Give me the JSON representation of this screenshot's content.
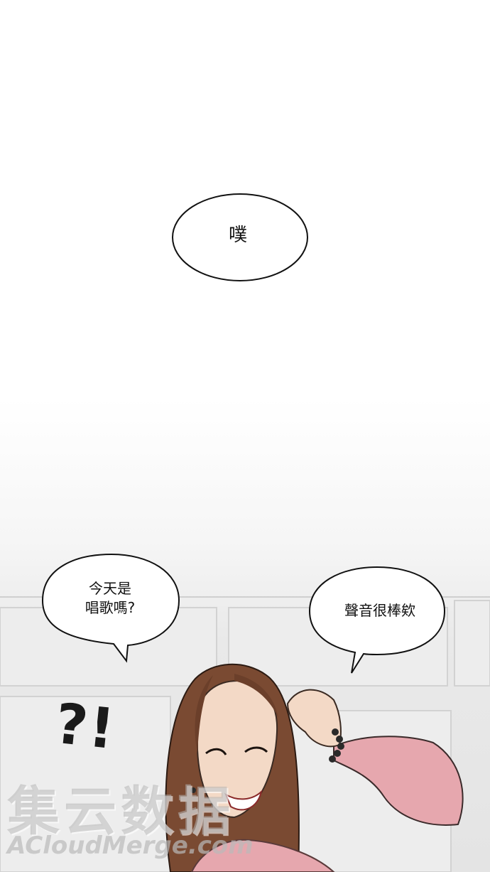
{
  "panel_top": {
    "bubble": {
      "text": "噗"
    }
  },
  "panel_bottom": {
    "bubble_left": {
      "line1": "今天是",
      "line2": "唱歌嗎?"
    },
    "bubble_right": {
      "text": "聲音很棒欸"
    },
    "reaction": "?!"
  },
  "watermark": {
    "chinese": "集云数据",
    "english": "ACloudMerge.com"
  },
  "colors": {
    "hair": "#7a4a32",
    "skin": "#f3d9c6",
    "sleeve": "#e6a7ae",
    "wall": "#e6e6e6"
  }
}
